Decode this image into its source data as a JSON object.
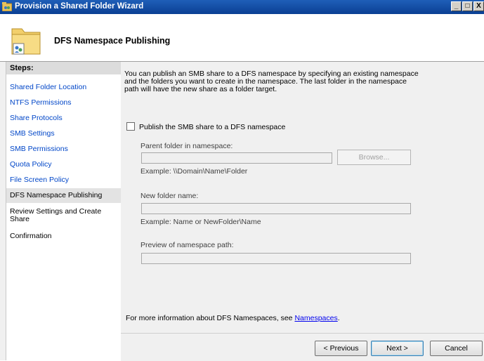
{
  "window": {
    "title": "Provision a Shared Folder Wizard",
    "minimize": "_",
    "maximize": "□",
    "close": "X"
  },
  "header": {
    "title": "DFS Namespace Publishing"
  },
  "steps": {
    "header": "Steps:",
    "items": [
      {
        "label": "Shared Folder Location"
      },
      {
        "label": "NTFS Permissions"
      },
      {
        "label": "Share Protocols"
      },
      {
        "label": "SMB Settings"
      },
      {
        "label": "SMB Permissions"
      },
      {
        "label": "Quota Policy"
      },
      {
        "label": "File Screen Policy"
      },
      {
        "label": "DFS Namespace Publishing"
      },
      {
        "label": "Review Settings and Create Share"
      },
      {
        "label": "Confirmation"
      }
    ]
  },
  "content": {
    "intro": "You can publish an SMB share to a DFS namespace by specifying an existing namespace and the folders you want to create in the namespace. The last folder in the namespace path will have the new share as a folder target.",
    "publish_checkbox_label": "Publish the SMB share to a DFS namespace",
    "publish_checked": false,
    "parent_folder_label": "Parent folder in namespace:",
    "parent_folder_value": "",
    "browse_label": "Browse...",
    "parent_folder_example": "Example: \\\\Domain\\Name\\Folder",
    "new_folder_label": "New folder name:",
    "new_folder_value": "",
    "new_folder_example": "Example: Name or NewFolder\\Name",
    "preview_label": "Preview of namespace path:",
    "preview_value": "",
    "more_info_text": "For more information about DFS Namespaces, see ",
    "more_info_link": "Namespaces",
    "more_info_suffix": "."
  },
  "footer": {
    "previous": "< Previous",
    "next": "Next >",
    "cancel": "Cancel"
  }
}
